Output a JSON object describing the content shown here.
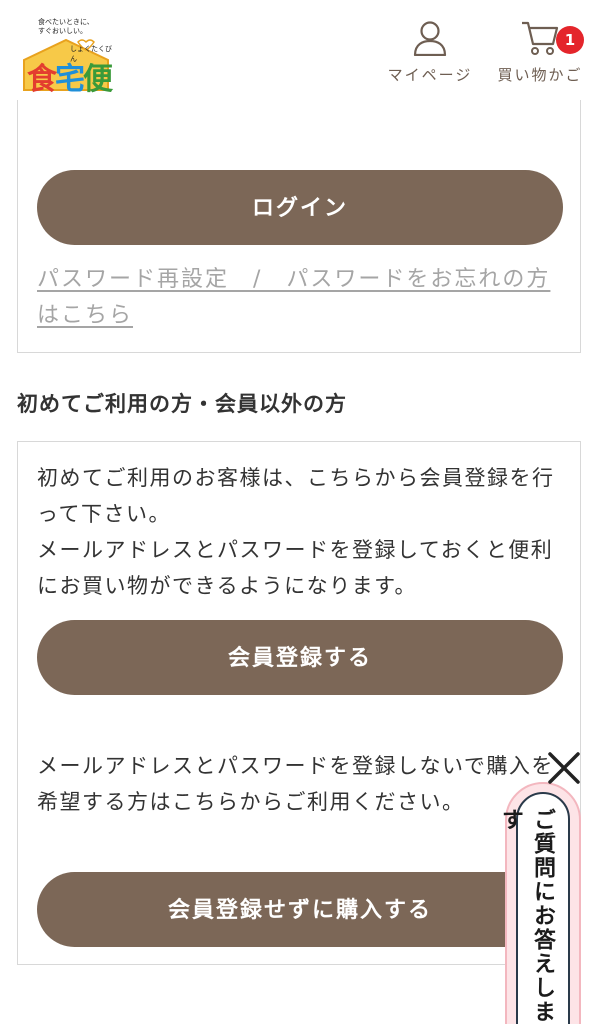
{
  "header": {
    "logo_tagline_line1": "食べたいときに、",
    "logo_tagline_line2": "すぐおいしい。",
    "logo_kana": "しょくたくびん",
    "logo_char1": "食",
    "logo_char2": "宅",
    "logo_char3": "便",
    "mypage_label": "マイページ",
    "cart_label": "買い物かご",
    "cart_count": "1"
  },
  "login": {
    "button_label": "ログイン",
    "forgot_link": "パスワード再設定　/　パスワードをお忘れの方はこちら"
  },
  "section_title": "初めてご利用の方・会員以外の方",
  "member": {
    "description": "初めてご利用のお客様は、こちらから会員登録を行って下さい。メールアドレスとパスワードを登録しておくと便利にお買い物ができるようになります。",
    "description_line1": "初めてご利用のお客様は、こちらから会員登録を行って下さい。",
    "description_line2": "メールアドレスとパスワードを登録しておくと便利にお買い物ができるようになります。",
    "register_button": "会員登録する",
    "guest_description": "メールアドレスとパスワードを登録しないで購入を希望する方はこちらからご利用ください。",
    "guest_button": "会員登録せずに購入する"
  },
  "faq_tab": {
    "label": "ご質問にお答えします"
  },
  "colors": {
    "button": "#7c6757",
    "badge": "#e4252b",
    "link": "#a5a5a5",
    "nav_text": "#6e5e52",
    "faq_bg": "#fde4e7"
  },
  "icons": {
    "mypage": "person-icon",
    "cart": "cart-icon",
    "close": "close-icon"
  }
}
